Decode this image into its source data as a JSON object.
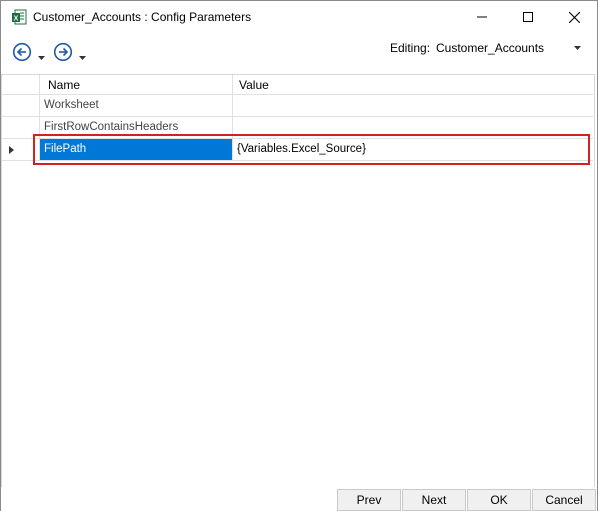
{
  "window": {
    "title": "Customer_Accounts : Config Parameters",
    "app_icon": "excel-icon"
  },
  "toolbar": {
    "editing_label": "Editing:",
    "editing_value": "Customer_Accounts"
  },
  "grid": {
    "columns": [
      "Name",
      "Value"
    ],
    "rows": [
      {
        "name": "Worksheet",
        "value": ""
      },
      {
        "name": "FirstRowContainsHeaders",
        "value": ""
      },
      {
        "name": "FilePath",
        "value": "{Variables.Excel_Source}"
      }
    ],
    "selected_row_index": 2
  },
  "footer": {
    "prev_label": "Prev",
    "next_label": "Next",
    "ok_label": "OK",
    "cancel_label": "Cancel"
  },
  "colors": {
    "selection": "#0078d7",
    "highlight_border": "#d42020",
    "nav_icon": "#1e5aa8"
  }
}
